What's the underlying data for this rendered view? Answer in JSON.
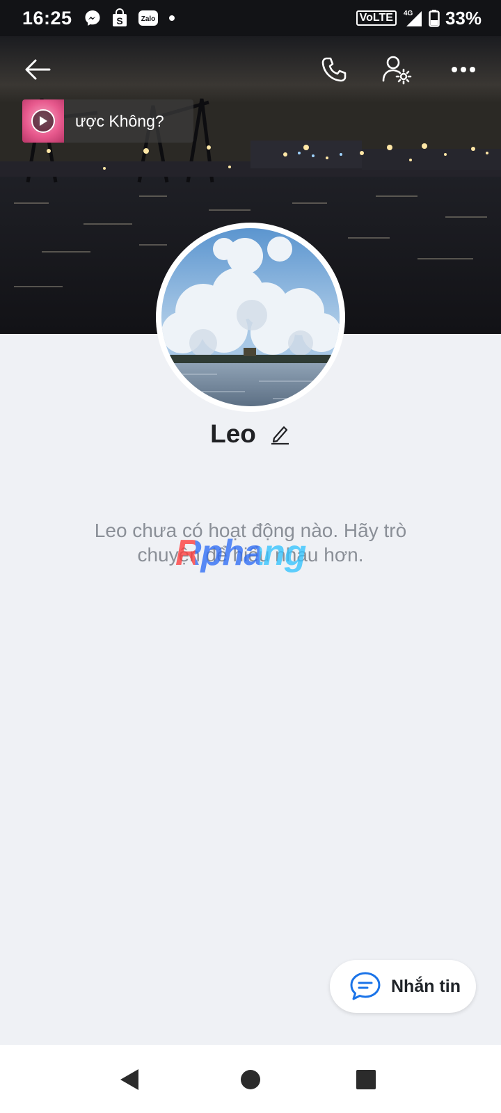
{
  "status_bar": {
    "time": "16:25",
    "app_icons": [
      "messenger-icon",
      "shopee-icon",
      "zalo-icon",
      "dot-icon"
    ],
    "zalo_label": "Zalo",
    "volte": "VoLTE",
    "network": "4G",
    "battery": "33%"
  },
  "header": {
    "back_icon": "arrow-left-icon",
    "call_icon": "phone-icon",
    "settings_icon": "user-settings-icon",
    "more_icon": "more-horizontal-icon"
  },
  "music": {
    "title": "ược Không?",
    "play_icon": "play-icon"
  },
  "profile": {
    "name": "Leo",
    "edit_icon": "pencil-icon",
    "empty_message": "Leo chưa có hoạt động nào. Hãy trò chuyện để hiểu nhau hơn."
  },
  "watermark": {
    "text": "Rphang"
  },
  "message_button": {
    "label": "Nhắn tin",
    "icon": "chat-bubble-icon"
  },
  "nav": {
    "back": "nav-back-icon",
    "home": "nav-home-icon",
    "recents": "nav-recents-icon"
  },
  "colors": {
    "background": "#eff1f5",
    "status_bar": "#121316",
    "accent": "#1a73e8",
    "text_primary": "#202124",
    "text_secondary": "#8a8f97"
  }
}
